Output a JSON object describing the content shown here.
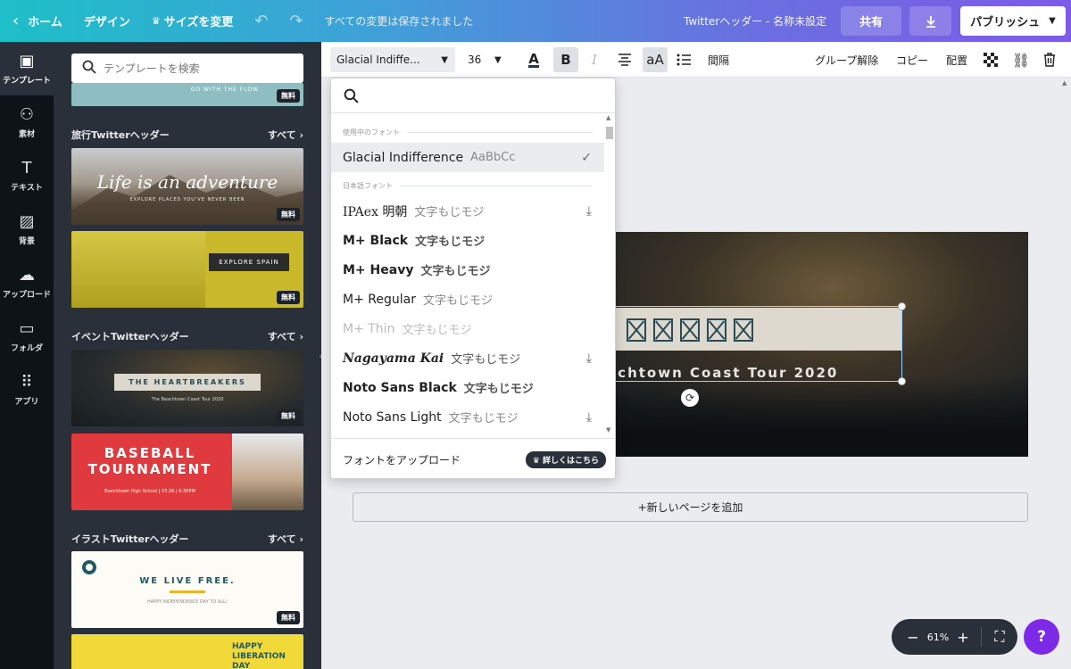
{
  "topbar": {
    "home": "ホーム",
    "design": "デザイン",
    "resize": "サイズを変更",
    "saved": "すべての変更は保存されました",
    "doc_title": "Twitterヘッダー - 名称未設定",
    "share": "共有",
    "publish": "パブリッシュ"
  },
  "rail": {
    "items": [
      {
        "label": "テンプレート",
        "icon": "layout-icon"
      },
      {
        "label": "素材",
        "icon": "shapes-icon"
      },
      {
        "label": "テキスト",
        "icon": "text-icon"
      },
      {
        "label": "背景",
        "icon": "background-icon"
      },
      {
        "label": "アップロード",
        "icon": "upload-cloud-icon"
      },
      {
        "label": "フォルダ",
        "icon": "folder-icon"
      },
      {
        "label": "アプリ",
        "icon": "apps-grid-icon"
      }
    ]
  },
  "panel": {
    "search_placeholder": "テンプレートを検索",
    "free_badge": "無料",
    "see_all": "すべて",
    "sections": [
      {
        "title": "旅行Twitterヘッダー"
      },
      {
        "title": "イベントTwitterヘッダー"
      },
      {
        "title": "イラストTwitterヘッダー"
      }
    ],
    "thumbs": {
      "t0": "GO WITH THE FLOW",
      "t1": "Life is an adventure",
      "t1_sub": "EXPLORE PLACES YOU'VE NEVER BEEN",
      "t2": "EXPLORE SPAIN",
      "t3": "THE HEARTBREAKERS",
      "t3_sub": "The Beachtown Coast Tour 2020",
      "t4a": "BASEBALL",
      "t4b": "TOURNAMENT",
      "t4_sub": "Beechtown High School | 03.26 | 6:30PM",
      "t5": "WE LIVE FREE.",
      "t5_sub": "HAPPY INDEPENDENCE DAY TO ALL!",
      "t6a": "HAPPY",
      "t6b": "LIBERATION DAY"
    }
  },
  "toolbar": {
    "font": "Glacial Indiffe...",
    "size": "36",
    "bold": "B",
    "italic": "I",
    "case": "aA",
    "spacing": "間隔",
    "ungroup": "グループ解除",
    "copy": "コピー",
    "arrange": "配置"
  },
  "dropdown": {
    "section_in_use": "使用中のフォント",
    "section_japanese": "日本語フォント",
    "selected": {
      "name": "Glacial Indifference",
      "sample": "AaBbCc"
    },
    "fonts": [
      {
        "name": "IPAex 明朝",
        "sample": "文字もじモジ",
        "download": true
      },
      {
        "name": "M+ Black",
        "sample": "文字もじモジ",
        "download": false
      },
      {
        "name": "M+ Heavy",
        "sample": "文字もじモジ",
        "download": false
      },
      {
        "name": "M+ Regular",
        "sample": "文字もじモジ",
        "download": false
      },
      {
        "name": "M+ Thin",
        "sample": "文字もじモジ",
        "download": false
      },
      {
        "name": "Nagayama Kai",
        "sample": "文字もじモジ",
        "download": true
      },
      {
        "name": "Noto Sans Black",
        "sample": "文字もじモジ",
        "download": false
      },
      {
        "name": "Noto Sans Light",
        "sample": "文字もじモジ",
        "download": true
      }
    ],
    "upload": "フォントをアップロード",
    "more": "詳しくはこちら"
  },
  "canvas": {
    "subtitle": "echtown Coast Tour 2020",
    "add_page": "+新しいページを追加"
  },
  "zoom": {
    "value": "61%"
  },
  "help": "?",
  "colors": {
    "accent": "#7d2ae8",
    "panel": "#293039",
    "rail": "#0e1318"
  }
}
